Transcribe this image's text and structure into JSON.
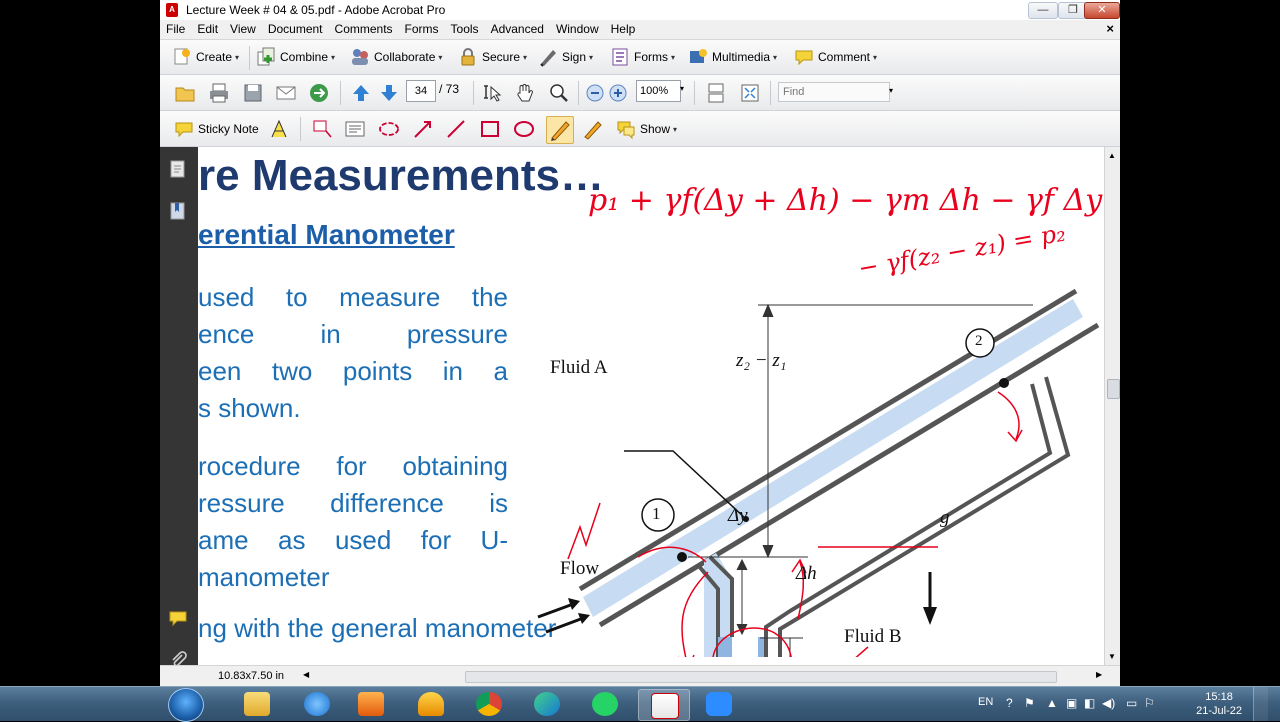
{
  "window": {
    "title": "Lecture Week # 04 & 05.pdf - Adobe Acrobat Pro",
    "minimize_glyph": "—",
    "maximize_glyph": "❐",
    "close_glyph": "✕"
  },
  "menu": {
    "items": [
      "File",
      "Edit",
      "View",
      "Document",
      "Comments",
      "Forms",
      "Tools",
      "Advanced",
      "Window",
      "Help"
    ],
    "doc_close_glyph": "×"
  },
  "toolbar1": {
    "create": "Create",
    "combine": "Combine",
    "collaborate": "Collaborate",
    "secure": "Secure",
    "sign": "Sign",
    "forms": "Forms",
    "multimedia": "Multimedia",
    "comment": "Comment",
    "dropdown_glyph": "▾"
  },
  "toolbar2": {
    "current_page": "34",
    "total_pages": "/ 73",
    "zoom": "100%",
    "find_placeholder": "Find"
  },
  "toolbar3": {
    "sticky_note": "Sticky Note",
    "show": "Show"
  },
  "slide": {
    "title": "re Measurements…",
    "subtitle": "erential Manometer",
    "bullet1_lines": [
      "used  to  measure  the",
      "ence      in      pressure",
      "een  two  points  in  a",
      "s  shown."
    ],
    "bullet2_lines": [
      "rocedure for obtaining",
      "ressure  difference  is",
      "ame  as  used  for  U-",
      "manometer"
    ],
    "bottom_line": "ng  with  the  general  manometer"
  },
  "figure": {
    "fluid_a": "Fluid A",
    "fluid_b": "Fluid B",
    "flow": "Flow",
    "point1": "1",
    "point2": "2",
    "z_label": "z₂ − z₁",
    "dy_label": "Δy",
    "dh_label": "Δh",
    "g_label": "g"
  },
  "annotations": {
    "equation_line1": "p₁ + γf(Δy + Δh) − γm Δh − γf Δy",
    "equation_line2": "− γf(z₂ − z₁) = p₂",
    "ink_color": "#e8001c"
  },
  "status": {
    "page_size": "10.83x7.50 in"
  },
  "taskbar": {
    "apps": [
      "explorer",
      "internet-explorer",
      "media-player",
      "audio-app",
      "chrome",
      "edge",
      "whatsapp",
      "acrobat",
      "zoom"
    ],
    "language": "EN",
    "time": "15:18",
    "date": "21-Jul-22"
  }
}
